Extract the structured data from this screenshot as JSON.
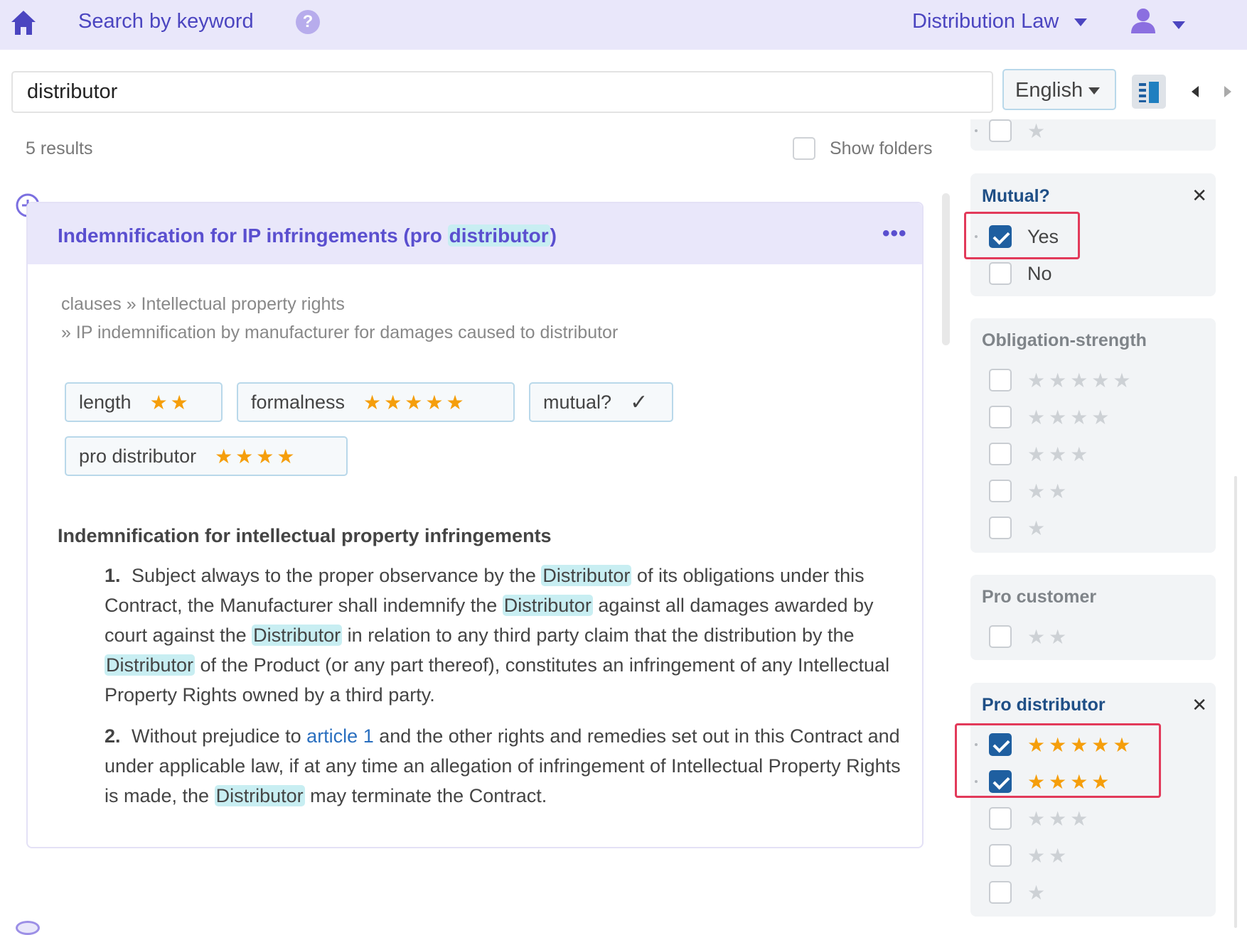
{
  "header": {
    "search_link": "Search by keyword",
    "help_glyph": "?",
    "domain": "Distribution Law"
  },
  "search": {
    "query": "distributor",
    "language": "English"
  },
  "results": {
    "count_label": "5 results",
    "show_folders_label": "Show folders"
  },
  "clause": {
    "title_prefix": "Indemnification for IP infringements (pro ",
    "title_highlight": "distributor",
    "title_suffix": ")",
    "more_glyph": "•••",
    "breadcrumb_line1": "clauses » Intellectual property rights",
    "breadcrumb_line2": "» IP indemnification by manufacturer for damages caused to distributor",
    "tags": [
      {
        "label": "length",
        "stars": "★★"
      },
      {
        "label": "formalness",
        "stars": "★★★★★"
      },
      {
        "label": "mutual?",
        "mark": "✓"
      },
      {
        "label": "pro distributor",
        "stars": "★★★★"
      }
    ],
    "heading": "Indemnification for intellectual property infringements",
    "p1": {
      "num": "1.",
      "s1": "Subject always to the proper observance by the ",
      "h1": "Distributor",
      "s2": " of its obligations under this Contract, the Manufacturer shall indemnify the ",
      "h2": "Distributor",
      "s3": " against all damages awarded by court against the ",
      "h3": "Distributor",
      "s4": " in relation to any third party claim that the distribution by the ",
      "h4": "Distributor",
      "s5": " of the Product (or any part thereof), constitutes an infringement of any Intellectual Property Rights owned by a third party."
    },
    "p2": {
      "num": "2.",
      "s1": "Without prejudice to ",
      "link": "article 1",
      "s2": " and the other rights and remedies set out in this Contract and under applicable law, if at any time an allegation of infringement of Intellectual Property Rights is made, the ",
      "h1": "Distributor",
      "s3": " may terminate the Contract."
    }
  },
  "facets": {
    "top_partial": {
      "stars": "★",
      "checked": false
    },
    "mutual": {
      "title": "Mutual?",
      "close": "✕",
      "options": [
        {
          "label": "Yes",
          "checked": true
        },
        {
          "label": "No",
          "checked": false
        }
      ]
    },
    "obligation_strength": {
      "title": "Obligation-strength",
      "options": [
        {
          "stars": "★★★★★",
          "checked": false
        },
        {
          "stars": "★★★★",
          "checked": false
        },
        {
          "stars": "★★★",
          "checked": false
        },
        {
          "stars": "★★",
          "checked": false
        },
        {
          "stars": "★",
          "checked": false
        }
      ]
    },
    "pro_customer": {
      "title": "Pro customer",
      "options": [
        {
          "stars": "★★",
          "checked": false
        }
      ]
    },
    "pro_distributor": {
      "title": "Pro distributor",
      "close": "✕",
      "options": [
        {
          "stars": "★★★★★",
          "checked": true
        },
        {
          "stars": "★★★★",
          "checked": true
        },
        {
          "stars": "★★★",
          "checked": false
        },
        {
          "stars": "★★",
          "checked": false
        },
        {
          "stars": "★",
          "checked": false
        }
      ]
    }
  },
  "colors": {
    "accent": "#5a4fcf",
    "header_bg": "#e9e7fa",
    "highlight": "#c8eef2",
    "star_active": "#f59e0b",
    "checkbox_checked": "#1f5fa0",
    "selection_frame": "#e23a5a"
  },
  "icons": [
    "home-icon",
    "help-icon",
    "user-icon",
    "layout-toggle-icon",
    "chevron-left-icon",
    "chevron-right-icon",
    "add-circle-icon",
    "more-icon",
    "close-icon",
    "star-icon",
    "checkmark-icon"
  ]
}
